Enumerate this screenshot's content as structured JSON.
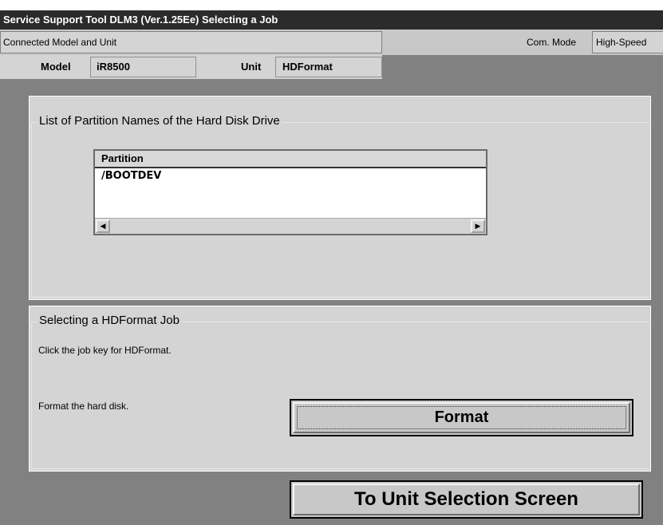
{
  "window": {
    "title": "Service Support Tool DLM3 (Ver.1.25Ee) Selecting a Job"
  },
  "connection": {
    "label": "Connected Model and Unit",
    "com_mode_label": "Com. Mode",
    "com_mode_value": "High-Speed"
  },
  "info": {
    "model_label": "Model",
    "model_value": "iR8500",
    "unit_label": "Unit",
    "unit_value": "HDFormat"
  },
  "partitions": {
    "group_title": "List of Partition Names of the Hard Disk Drive",
    "column_header": "Partition",
    "rows": [
      "/BOOTDEV"
    ]
  },
  "job": {
    "group_title": "Selecting a HDFormat Job",
    "instruction": "Click the job key for HDFormat.",
    "format_description": "Format the hard disk.",
    "format_button": "Format"
  },
  "footer": {
    "unit_selection_button": "To Unit Selection Screen"
  },
  "icons": {
    "scroll_left": "arrow-left",
    "scroll_right": "arrow-right"
  }
}
